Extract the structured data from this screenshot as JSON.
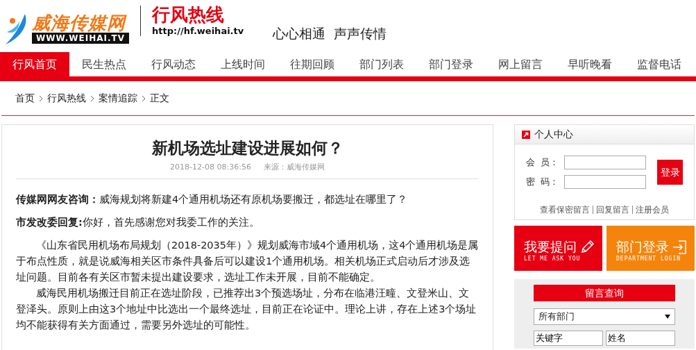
{
  "header": {
    "site_name": "威海传媒网",
    "site_url": "WWW.WEIHAI.TV",
    "channel_name": "行风热线",
    "channel_url": "http://hf.weihai.tv",
    "slogan": "心心相通  声声传情"
  },
  "nav": [
    {
      "label": "行风首页",
      "selected": true
    },
    {
      "label": "民生热点",
      "selected": false
    },
    {
      "label": "行风动态",
      "selected": false
    },
    {
      "label": "上线时间",
      "selected": false
    },
    {
      "label": "往期回顾",
      "selected": false
    },
    {
      "label": "部门列表",
      "selected": false
    },
    {
      "label": "部门登录",
      "selected": false
    },
    {
      "label": "网上留言",
      "selected": false
    },
    {
      "label": "早听晚看",
      "selected": false
    },
    {
      "label": "监督电话",
      "selected": false
    }
  ],
  "breadcrumb": [
    "首页",
    "行风热线",
    "案情追踪",
    "正文"
  ],
  "article": {
    "title": "新机场选址建设进展如何？",
    "date": "2018-12-08 08:36:56",
    "source": "来源：威海传媒网",
    "paragraphs": [
      {
        "kind": "qa",
        "label": "传媒网网友咨询：",
        "text": "威海规划将新建4个通用机场还有原机场要搬迁，都选址在哪里了？"
      },
      {
        "kind": "qa",
        "label": "市发改委回复:",
        "text": "你好，首先感谢您对我委工作的关注。"
      },
      {
        "kind": "body",
        "text": "《山东省民用机场布局规划（2018-2035年）》规划威海市域4个通用机场，这4个通用机场是属于布点性质，就是说威海相关区市条件具备后可以建设1个通用机场。相关机场正式启动后才涉及选址问题。目前各有关区市暂未提出建设要求，选址工作未开展，目前不能确定。"
      },
      {
        "kind": "body",
        "text": "威海民用机场搬迁目前正在选址阶段，已推荐出3个预选场址，分布在临港汪疃、文登米山、文登泽头。原则上由这3个地址中比选出一个最终选址，目前正在论证中。理论上讲，存在上述3个场址均不能获得有关方面通过，需要另外选址的可能性。"
      }
    ]
  },
  "user_center": {
    "title": "个人中心",
    "member_label": "会  员：",
    "password_label": "密  码：",
    "login_button": "登录",
    "links": [
      "查看保密留言",
      "回复留言",
      "注册会员"
    ]
  },
  "promo_buttons": [
    {
      "kind": "ask",
      "title": "我要提问",
      "subtitle": "LET ME ASK YOU"
    },
    {
      "kind": "login",
      "title": "部门登录",
      "subtitle": "DEPARTMENT LOGIN"
    }
  ],
  "message_search": {
    "title": "留言查询",
    "department": "所有部门",
    "keyword": "关键字",
    "name": "姓名"
  }
}
